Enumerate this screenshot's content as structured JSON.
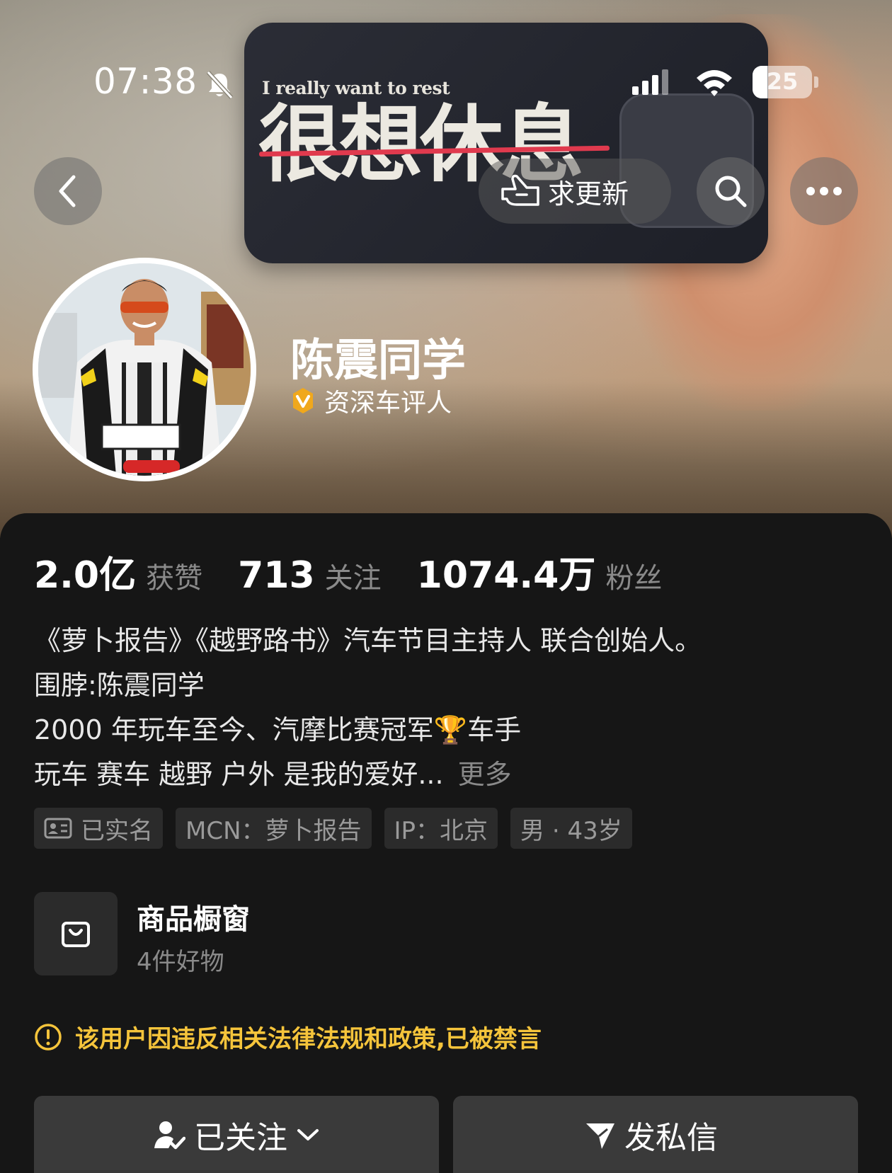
{
  "status_bar": {
    "time": "07:38",
    "battery": "25",
    "battery_level": 0.25
  },
  "banner": {
    "english_text": "I really want to rest",
    "chinese_text": "很想休息"
  },
  "nav": {
    "update_button": "求更新"
  },
  "profile": {
    "name": "陈震同学",
    "verified_title": "资深车评人"
  },
  "stats": [
    {
      "value": "2.0亿",
      "label": "获赞"
    },
    {
      "value": "713",
      "label": "关注"
    },
    {
      "value": "1074.4万",
      "label": "粉丝"
    }
  ],
  "bio": {
    "lines": [
      "《萝卜报告》《越野路书》汽车节目主持人 联合创始人。",
      "围脖:陈震同学",
      "2000 年玩车至今、汽摩比赛冠军🏆车手",
      "玩车 赛车 越野 户外 是我的爱好..."
    ],
    "more": "更多"
  },
  "tags": [
    {
      "label": "已实名",
      "icon": "id-card-icon"
    },
    {
      "label": "MCN：萝卜报告"
    },
    {
      "label": "IP：北京"
    },
    {
      "label": "男 · 43岁"
    }
  ],
  "shop": {
    "title": "商品橱窗",
    "subtitle": "4件好物",
    "icon": "shopping-bag-icon"
  },
  "warning": {
    "text": "该用户因违反相关法律法规和政策,已被禁言",
    "color": "#f5c43b"
  },
  "actions": {
    "follow": "已关注",
    "message": "发私信"
  },
  "colors": {
    "background": "#161616",
    "accent_warning": "#f5c43b",
    "verified_badge": "#f0a81c"
  }
}
